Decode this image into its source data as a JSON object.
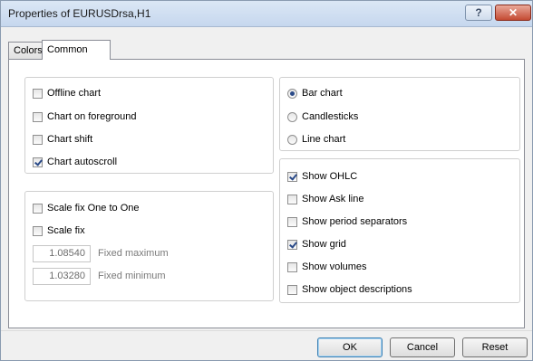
{
  "window": {
    "title": "Properties of EURUSDrsa,H1",
    "help_label": "?",
    "close_label": "✕"
  },
  "tabs": [
    {
      "label": "Colors",
      "active": false
    },
    {
      "label": "Common",
      "active": true
    }
  ],
  "left_top_group": {
    "checkboxes": [
      {
        "label": "Offline chart",
        "checked": false
      },
      {
        "label": "Chart on foreground",
        "checked": false
      },
      {
        "label": "Chart shift",
        "checked": false
      },
      {
        "label": "Chart autoscroll",
        "checked": true
      }
    ]
  },
  "left_bottom_group": {
    "checkboxes": [
      {
        "label": "Scale fix One to One",
        "checked": false
      },
      {
        "label": "Scale fix",
        "checked": false
      }
    ],
    "fixed_maximum": {
      "value": "1.08540",
      "label": "Fixed maximum"
    },
    "fixed_minimum": {
      "value": "1.03280",
      "label": "Fixed minimum"
    }
  },
  "chart_type_group": {
    "radios": [
      {
        "label": "Bar chart",
        "checked": true
      },
      {
        "label": "Candlesticks",
        "checked": false
      },
      {
        "label": "Line chart",
        "checked": false
      }
    ]
  },
  "show_group": {
    "checkboxes": [
      {
        "label": "Show OHLC",
        "checked": true
      },
      {
        "label": "Show Ask line",
        "checked": false
      },
      {
        "label": "Show period separators",
        "checked": false
      },
      {
        "label": "Show grid",
        "checked": true
      },
      {
        "label": "Show volumes",
        "checked": false
      },
      {
        "label": "Show object descriptions",
        "checked": false
      }
    ]
  },
  "buttons": {
    "ok": "OK",
    "cancel": "Cancel",
    "reset": "Reset"
  }
}
